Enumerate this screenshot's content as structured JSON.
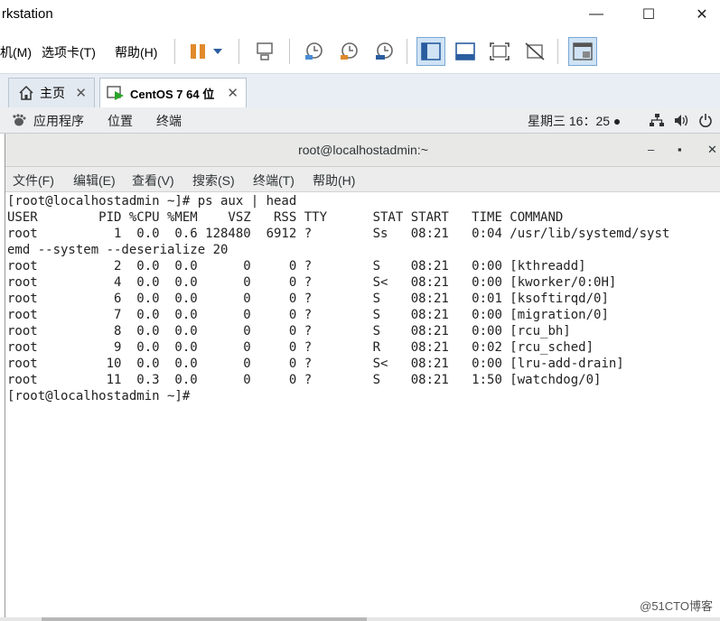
{
  "vmware": {
    "title": "rkstation",
    "menu": [
      "机(M)",
      "选项卡(T)",
      "帮助(H)"
    ],
    "window_controls": {
      "minimize": "—",
      "maximize": "☐",
      "close": "✕"
    },
    "tabs": [
      {
        "label": "主页",
        "close": "✕"
      },
      {
        "label": "CentOS 7 64 位",
        "close": "✕"
      }
    ]
  },
  "gnome": {
    "apps": "应用程序",
    "places": "位置",
    "terminal": "终端",
    "clock": "星期三 16：25 ●",
    "icons": [
      "network-icon",
      "volume-icon",
      "power-icon"
    ]
  },
  "terminal": {
    "title": "root@localhostadmin:~",
    "controls": {
      "minimize": "–",
      "maximize": "▪",
      "close": "✕"
    },
    "menu": [
      "文件(F)",
      "编辑(E)",
      "查看(V)",
      "搜索(S)",
      "终端(T)",
      "帮助(H)"
    ],
    "lines": [
      "[root@localhostadmin ~]# ps aux | head",
      "USER        PID %CPU %MEM    VSZ   RSS TTY      STAT START   TIME COMMAND",
      "root          1  0.0  0.6 128480  6912 ?        Ss   08:21   0:04 /usr/lib/systemd/syst",
      "emd --system --deserialize 20",
      "root          2  0.0  0.0      0     0 ?        S    08:21   0:00 [kthreadd]",
      "root          4  0.0  0.0      0     0 ?        S<   08:21   0:00 [kworker/0:0H]",
      "root          6  0.0  0.0      0     0 ?        S    08:21   0:01 [ksoftirqd/0]",
      "root          7  0.0  0.0      0     0 ?        S    08:21   0:00 [migration/0]",
      "root          8  0.0  0.0      0     0 ?        S    08:21   0:00 [rcu_bh]",
      "root          9  0.0  0.0      0     0 ?        R    08:21   0:02 [rcu_sched]",
      "root         10  0.0  0.0      0     0 ?        S<   08:21   0:00 [lru-add-drain]",
      "root         11  0.3  0.0      0     0 ?        S    08:21   1:50 [watchdog/0]",
      "[root@localhostadmin ~]#"
    ]
  },
  "watermark": "@51CTO博客"
}
